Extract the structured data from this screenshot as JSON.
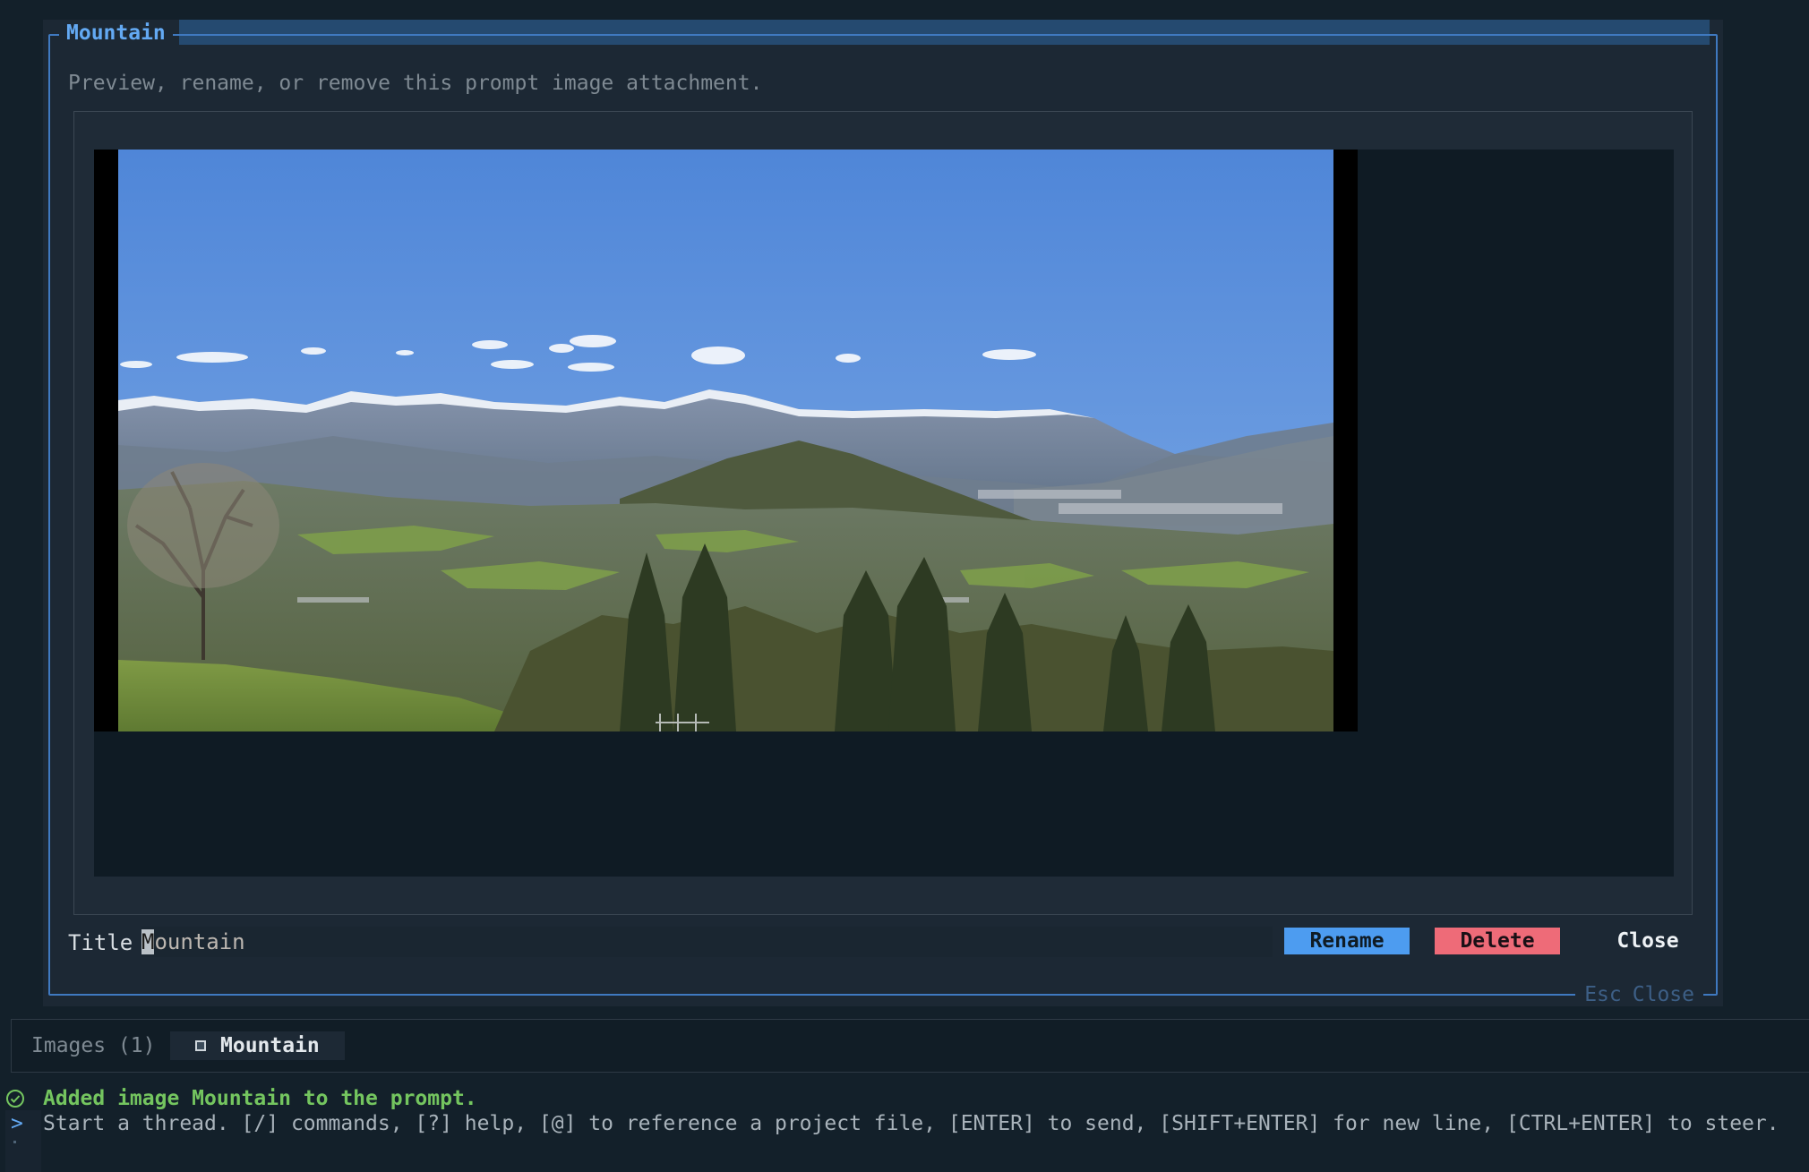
{
  "modal": {
    "title": "Mountain",
    "subtitle": "Preview, rename, or remove this prompt image attachment.",
    "title_field": {
      "label": "Title",
      "value": "Mountain"
    },
    "buttons": {
      "rename": "Rename",
      "delete": "Delete",
      "close": "Close"
    },
    "esc_hint": {
      "key": "Esc",
      "action": "Close"
    }
  },
  "attachments": {
    "label": "Images (1)",
    "items": [
      {
        "label": "Mountain",
        "icon": "image-icon"
      }
    ]
  },
  "status": {
    "icon": "check-circle-icon",
    "text": "Added image Mountain to the prompt."
  },
  "prompt": {
    "caret": ">",
    "placeholder": "Start a thread. [/] commands, [?] help, [@] to reference a project file, [ENTER] to send, [SHIFT+ENTER] for new line, [CTRL+ENTER] to steer."
  },
  "colors": {
    "accent": "#4d9cf0",
    "danger": "#ee6b78",
    "success": "#74c55f",
    "background": "#13202a",
    "modal_bg": "#1c2834"
  }
}
